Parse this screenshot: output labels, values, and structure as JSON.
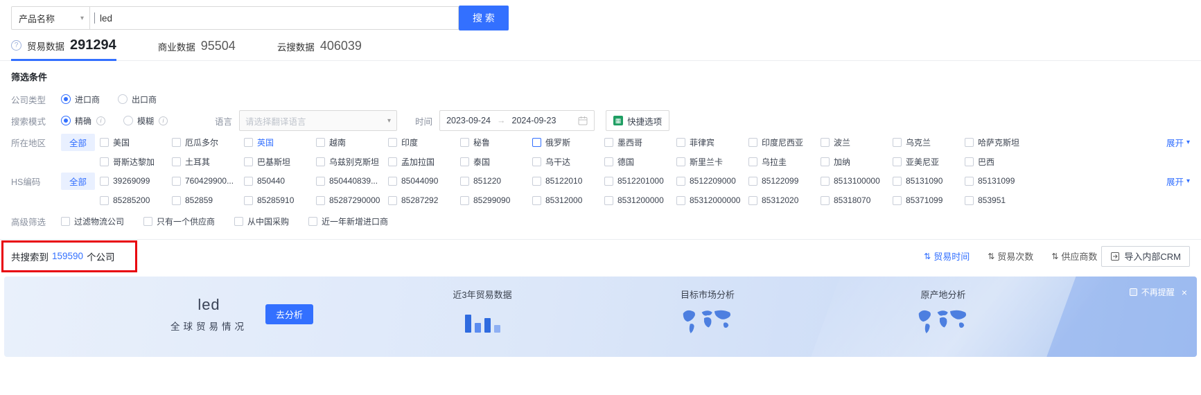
{
  "search": {
    "category": "产品名称",
    "query": "led",
    "button": "搜 索"
  },
  "tabs": {
    "trade": {
      "label": "贸易数据",
      "count": "291294"
    },
    "business": {
      "label": "商业数据",
      "count": "95504"
    },
    "cloud": {
      "label": "云搜数据",
      "count": "406039"
    }
  },
  "filter": {
    "title": "筛选条件",
    "company_type_label": "公司类型",
    "company_types": [
      {
        "label": "进口商",
        "cls": "checked"
      },
      {
        "label": "出口商"
      }
    ],
    "search_mode_label": "搜索模式",
    "search_modes": [
      {
        "label": "精确",
        "cls": "checked"
      },
      {
        "label": "模糊"
      }
    ],
    "language_label": "语言",
    "language_placeholder": "请选择翻译语言",
    "time_label": "时间",
    "time_start": "2023-09-24",
    "time_arrow": "→",
    "time_end": "2024-09-23",
    "quick_option": "快捷选项",
    "region_label": "所在地区",
    "all_tag": "全部",
    "expand": "展开",
    "region_row1": [
      "美国",
      "厄瓜多尔",
      {
        "label": "英国",
        "cls": "label-blue"
      },
      "越南",
      "印度",
      "秘鲁",
      {
        "label": "俄罗斯",
        "cls": "cb-blue"
      },
      "墨西哥",
      "菲律宾",
      "印度尼西亚",
      "波兰",
      "乌克兰",
      "哈萨克斯坦"
    ],
    "region_row2": [
      "哥斯达黎加",
      "土耳其",
      "巴基斯坦",
      "乌兹别克斯坦",
      "孟加拉国",
      "泰国",
      "乌干达",
      "德国",
      "斯里兰卡",
      "乌拉圭",
      "加纳",
      "亚美尼亚",
      "巴西"
    ],
    "hs_label": "HS编码",
    "hs_row1": [
      "39269099",
      "760429900...",
      "850440",
      "850440839...",
      "85044090",
      "851220",
      "85122010",
      "8512201000",
      "8512209000",
      "85122099",
      "8513100000",
      "85131090",
      "85131099"
    ],
    "hs_row2": [
      "85285200",
      "852859",
      "85285910",
      "85287290000",
      "85287292",
      "85299090",
      "85312000",
      "8531200000",
      "85312000000",
      "85312020",
      "85318070",
      "85371099",
      "853951"
    ],
    "advanced_label": "高级筛选",
    "advanced": [
      "过滤物流公司",
      "只有一个供应商",
      "从中国采购",
      "近一年新增进口商"
    ]
  },
  "results": {
    "prefix": "共搜索到",
    "count": "159590",
    "suffix": "个公司",
    "sorts": [
      {
        "label": "贸易时间",
        "cls": "active"
      },
      {
        "label": "贸易次数"
      },
      {
        "label": "供应商数"
      }
    ],
    "crm_button": "导入内部CRM"
  },
  "banner": {
    "keyword": "led",
    "subtitle": "全球贸易情况",
    "analyze": "去分析",
    "card1": "近3年贸易数据",
    "card2": "目标市场分析",
    "card3": "原产地分析",
    "dismiss": "不再提醒"
  },
  "colors": {
    "primary": "#3370ff",
    "annotation": "#e8000d",
    "quick_icon_green": "#1f9e63"
  }
}
